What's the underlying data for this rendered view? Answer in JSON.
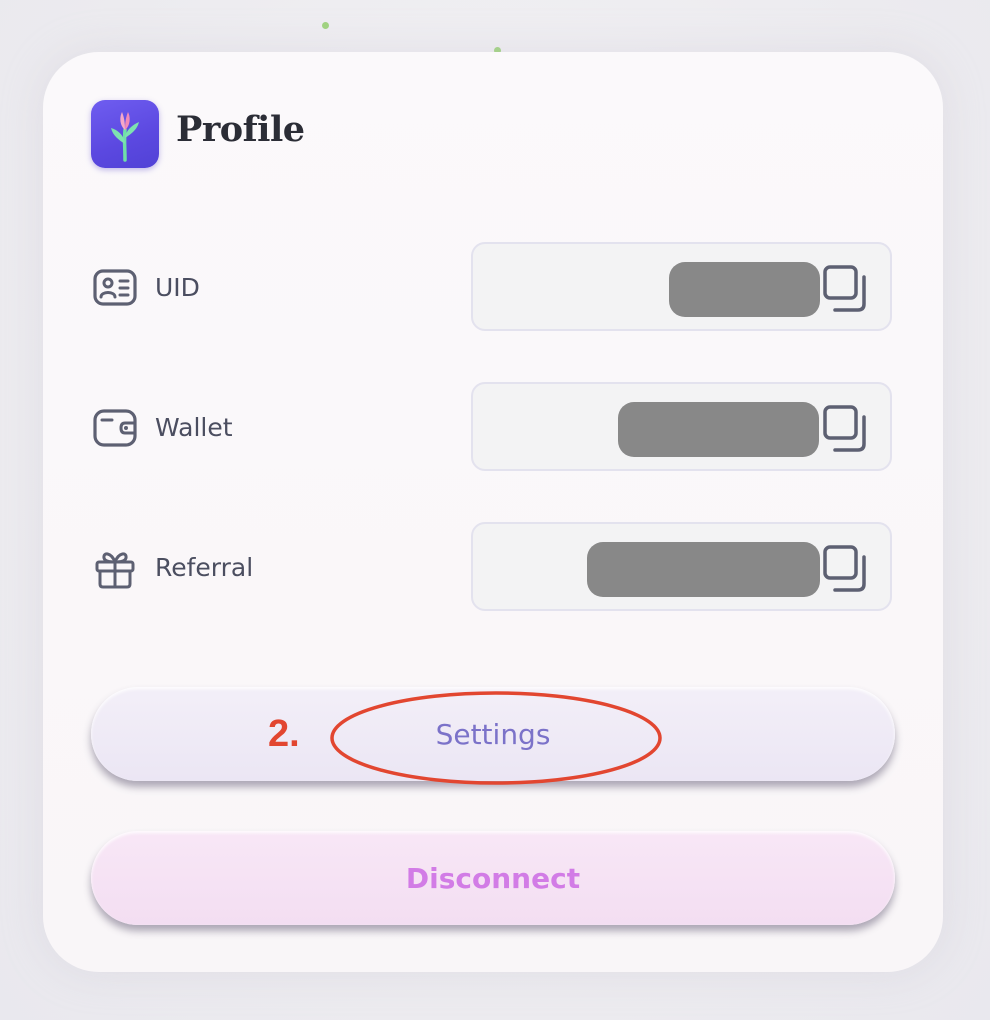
{
  "profile": {
    "title": "Profile",
    "logo_icon": "flower-icon",
    "rows": [
      {
        "label": "UID",
        "icon": "id-card-icon"
      },
      {
        "label": "Wallet",
        "icon": "wallet-icon"
      },
      {
        "label": "Referral",
        "icon": "gift-icon"
      }
    ],
    "copy_icon": "copy-icon"
  },
  "buttons": {
    "settings": "Settings",
    "disconnect": "Disconnect"
  },
  "annotation": {
    "step": "2."
  },
  "colors": {
    "logo": "#5b48e0",
    "settings_text": "#7b72c9",
    "disconnect_text": "#d27ce6",
    "annotation": "#e24630",
    "redaction": "#888888"
  }
}
